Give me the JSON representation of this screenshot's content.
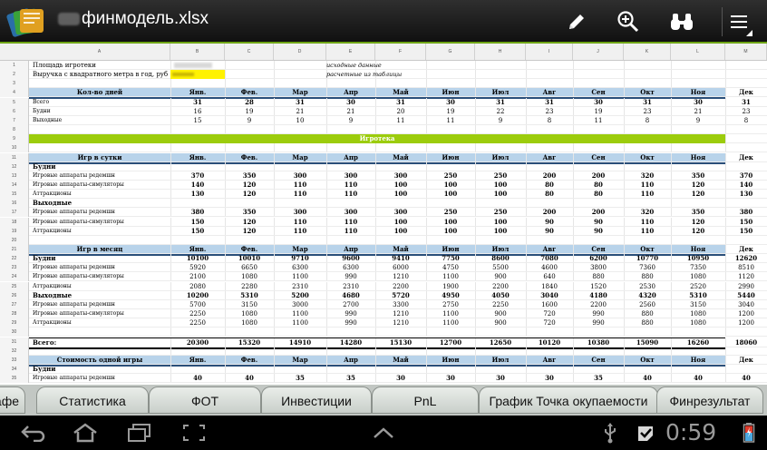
{
  "app": {
    "title": "финмодель.xlsx",
    "icons": [
      "app-logo-icon",
      "pencil-icon",
      "zoom-in-icon",
      "binoculars-icon",
      "overflow-menu-icon"
    ]
  },
  "colors": {
    "accent_green": "#6fa516",
    "header_band": "#b8d3ea",
    "section_band": "#9ccc0c",
    "highlight": "#fff200"
  },
  "grid": {
    "col_letters": [
      "A",
      "B",
      "C",
      "D",
      "E",
      "F",
      "G",
      "H",
      "I",
      "J",
      "K",
      "L",
      "M",
      "N"
    ],
    "months": [
      "Янв",
      "Фев",
      "Мар",
      "Апр",
      "Май",
      "Июн",
      "Июл",
      "Авг",
      "Сен",
      "Окт",
      "Ноя",
      "Дек"
    ],
    "months_dot": [
      "Янв.",
      "Фев.",
      "Мар",
      "Апр",
      "Май",
      "Июн",
      "Июл",
      "Авг",
      "Сен",
      "Окт",
      "Ноя",
      "Дек"
    ],
    "rows": [
      {
        "n": "1",
        "a": "Площадь игротеки",
        "e": "исходные данные",
        "blur": true
      },
      {
        "n": "2",
        "a": "Выручка с квадратного метра в год, руб",
        "e": "расчетные из таблицы",
        "yellow": true
      },
      {
        "n": "3"
      },
      {
        "n": "4",
        "header": "Кол-во дней",
        "dot": true,
        "band": true
      },
      {
        "n": "5",
        "a": "Всего",
        "bold": true,
        "v": [
          "31",
          "28",
          "31",
          "30",
          "31",
          "30",
          "31",
          "31",
          "30",
          "31",
          "30",
          "31"
        ]
      },
      {
        "n": "6",
        "a": "Будни",
        "v": [
          "16",
          "19",
          "21",
          "21",
          "20",
          "19",
          "22",
          "23",
          "19",
          "23",
          "21",
          "23"
        ]
      },
      {
        "n": "7",
        "a": "Выходные",
        "v": [
          "15",
          "9",
          "10",
          "9",
          "11",
          "11",
          "9",
          "8",
          "11",
          "8",
          "9",
          "8"
        ]
      },
      {
        "n": "8"
      },
      {
        "n": "9",
        "section": "Игротека"
      },
      {
        "n": "10"
      },
      {
        "n": "11",
        "header": "Игр в сутки",
        "dot": true,
        "band": true
      },
      {
        "n": "12",
        "a": "Будни",
        "abold": true
      },
      {
        "n": "13",
        "a": "Игровые аппараты редемшн",
        "bold": true,
        "v": [
          "370",
          "350",
          "300",
          "300",
          "300",
          "250",
          "250",
          "200",
          "200",
          "320",
          "350",
          "370"
        ]
      },
      {
        "n": "14",
        "a": "Игровые аппараты-симуляторы",
        "bold": true,
        "v": [
          "140",
          "120",
          "110",
          "110",
          "100",
          "100",
          "100",
          "80",
          "80",
          "110",
          "120",
          "140"
        ]
      },
      {
        "n": "15",
        "a": "Аттракционы",
        "bold": true,
        "v": [
          "130",
          "120",
          "110",
          "110",
          "100",
          "100",
          "100",
          "80",
          "80",
          "110",
          "120",
          "130"
        ]
      },
      {
        "n": "16",
        "a": "Выходные",
        "abold": true
      },
      {
        "n": "17",
        "a": "Игровые аппараты редемшн",
        "bold": true,
        "v": [
          "380",
          "350",
          "300",
          "300",
          "300",
          "250",
          "250",
          "200",
          "200",
          "320",
          "350",
          "380"
        ]
      },
      {
        "n": "18",
        "a": "Игровые аппараты-симуляторы",
        "bold": true,
        "v": [
          "150",
          "120",
          "110",
          "110",
          "100",
          "100",
          "100",
          "90",
          "90",
          "110",
          "120",
          "150"
        ]
      },
      {
        "n": "19",
        "a": "Аттракционы",
        "bold": true,
        "v": [
          "150",
          "120",
          "110",
          "110",
          "100",
          "100",
          "100",
          "90",
          "90",
          "110",
          "120",
          "150"
        ]
      },
      {
        "n": "20"
      },
      {
        "n": "21",
        "header": "Игр в месяц",
        "dot": true,
        "band": true
      },
      {
        "n": "22",
        "a": "Будни",
        "abold": true,
        "bold": true,
        "v": [
          "10100",
          "10010",
          "9710",
          "9600",
          "9410",
          "7750",
          "8600",
          "7080",
          "6200",
          "10770",
          "10950",
          "12620"
        ]
      },
      {
        "n": "23",
        "a": "Игровые аппараты редемшн",
        "v": [
          "5920",
          "6650",
          "6300",
          "6300",
          "6000",
          "4750",
          "5500",
          "4600",
          "3800",
          "7360",
          "7350",
          "8510"
        ]
      },
      {
        "n": "24",
        "a": "Игровые аппараты-симуляторы",
        "v": [
          "2100",
          "1080",
          "1100",
          "990",
          "1210",
          "1100",
          "900",
          "640",
          "880",
          "880",
          "1080",
          "1120"
        ]
      },
      {
        "n": "25",
        "a": "Аттракционы",
        "v": [
          "2080",
          "2280",
          "2310",
          "2310",
          "2200",
          "1900",
          "2200",
          "1840",
          "1520",
          "2530",
          "2520",
          "2990"
        ]
      },
      {
        "n": "26",
        "a": "Выходные",
        "abold": true,
        "bold": true,
        "v": [
          "10200",
          "5310",
          "5200",
          "4680",
          "5720",
          "4950",
          "4050",
          "3040",
          "4180",
          "4320",
          "5310",
          "5440"
        ]
      },
      {
        "n": "27",
        "a": "Игровые аппараты редемшн",
        "v": [
          "5700",
          "3150",
          "3000",
          "2700",
          "3300",
          "2750",
          "2250",
          "1600",
          "2200",
          "2560",
          "3150",
          "3040"
        ]
      },
      {
        "n": "28",
        "a": "Игровые аппараты-симуляторы",
        "v": [
          "2250",
          "1080",
          "1100",
          "990",
          "1210",
          "1100",
          "900",
          "720",
          "990",
          "880",
          "1080",
          "1200"
        ]
      },
      {
        "n": "29",
        "a": "Аттракционы",
        "v": [
          "2250",
          "1080",
          "1100",
          "990",
          "1210",
          "1100",
          "900",
          "720",
          "990",
          "880",
          "1080",
          "1200"
        ]
      },
      {
        "n": "30"
      },
      {
        "n": "31",
        "a": "Всего:",
        "bold": true,
        "total": true,
        "v": [
          "20300",
          "15320",
          "14910",
          "14280",
          "15130",
          "12700",
          "12650",
          "10120",
          "10380",
          "15090",
          "16260",
          "18060"
        ]
      },
      {
        "n": "32"
      },
      {
        "n": "33",
        "header": "Стоимость одной игры",
        "dot": true,
        "band": true
      },
      {
        "n": "34",
        "a": "Будни",
        "abold": true
      },
      {
        "n": "35",
        "a": "Игровые аппараты редемшн",
        "bold": true,
        "v": [
          "40",
          "40",
          "35",
          "35",
          "30",
          "30",
          "30",
          "30",
          "35",
          "40",
          "40",
          "40"
        ]
      }
    ]
  },
  "tabs": [
    "афе",
    "Статистика",
    "ФОТ",
    "Инвестиции",
    "PnL",
    "График Точка окупаемости",
    "Финрезультат"
  ],
  "system_bar": {
    "time": "0:59",
    "icons": [
      "back-icon",
      "home-icon",
      "recent-apps-icon",
      "screenshot-icon",
      "up-arrow-icon",
      "usb-icon",
      "task-check-icon",
      "battery-charging-icon"
    ]
  }
}
